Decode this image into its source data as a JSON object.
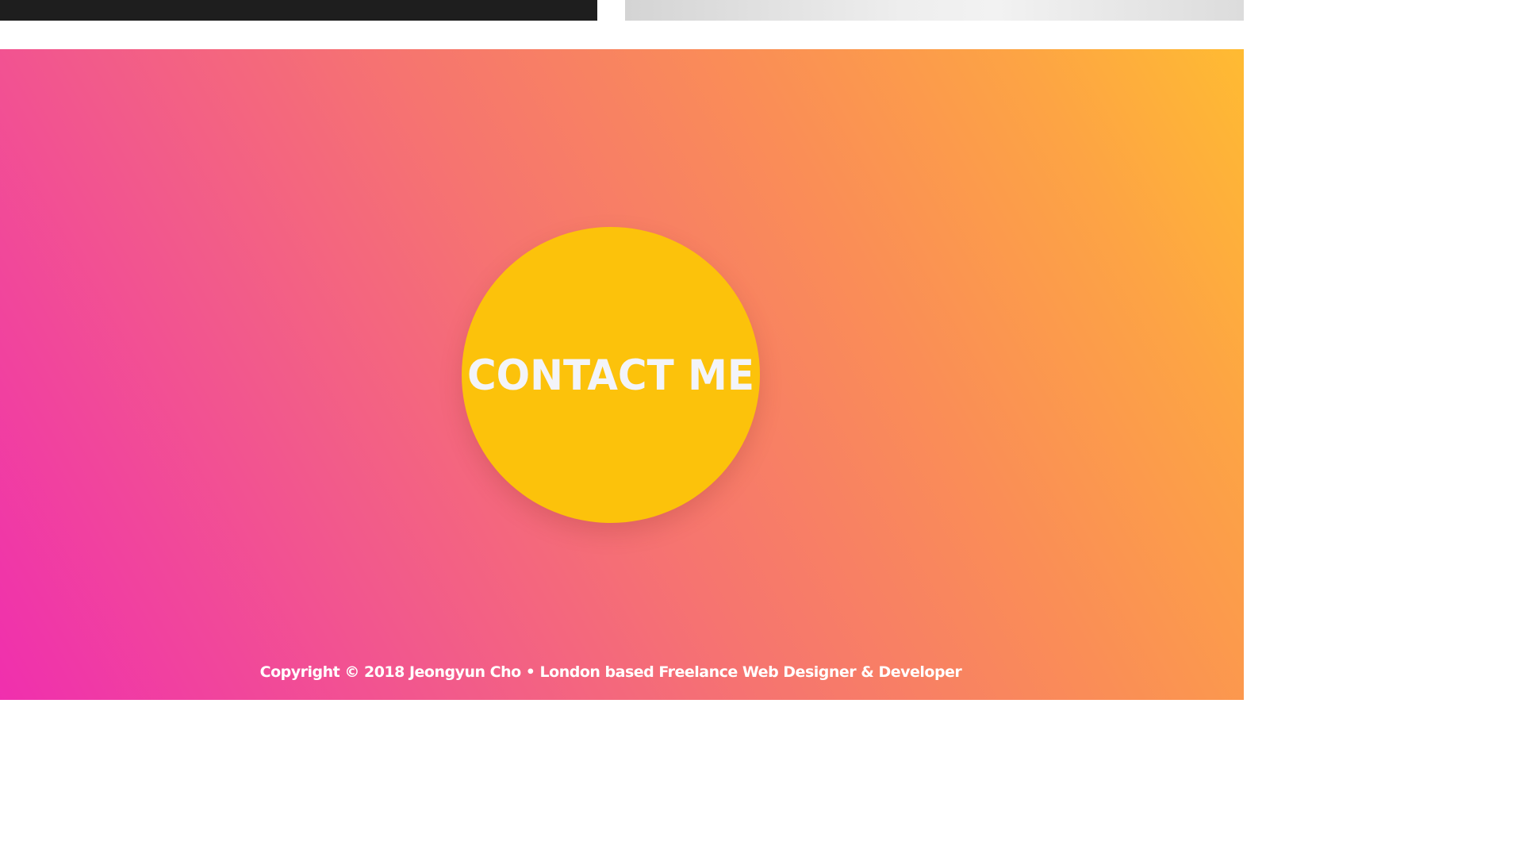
{
  "contact": {
    "button_label": "CONTACT ME"
  },
  "footer": {
    "copyright": "Copyright © 2018 Jeongyun Cho • London based Freelance Web Designer & Developer"
  },
  "colors": {
    "gradient_start": "#f02fae",
    "gradient_mid": "#f6756f",
    "gradient_end": "#ffbb32",
    "circle": "#fcc20b",
    "text": "#ffffff",
    "dark_panel": "#1e1e1e"
  }
}
